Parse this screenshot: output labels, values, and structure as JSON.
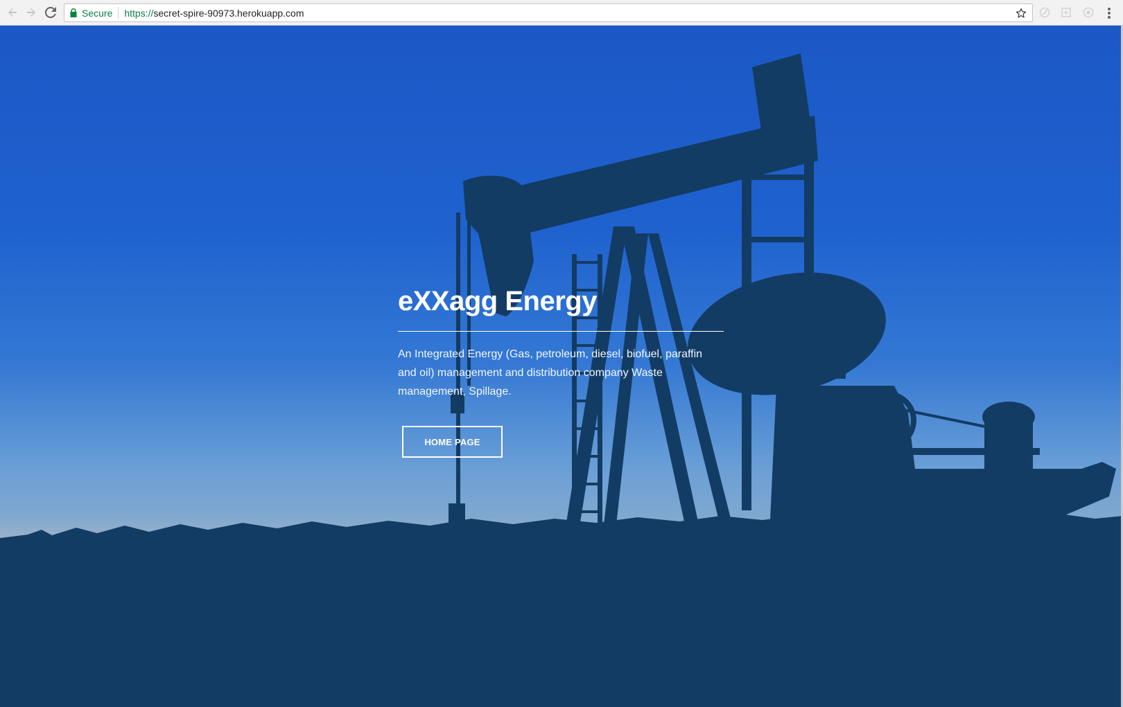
{
  "browser": {
    "secure_label": "Secure",
    "url_scheme": "https://",
    "url_host": "secret-spire-90973.herokuapp.com",
    "icons": [
      "back-arrow-icon",
      "forward-arrow-icon",
      "reload-icon",
      "lock-icon",
      "star-icon",
      "extension-icon",
      "menu-icon"
    ],
    "secure_color": "#0b8043"
  },
  "hero": {
    "title": "eXXagg Energy",
    "description": "An Integrated Energy (Gas, petroleum, diesel, biofuel, paraffin and oil) management and distribution company Waste management, Spillage.",
    "button_label": "HOME PAGE"
  },
  "colors": {
    "sky_top": "#1b58c6",
    "ground": "#0f355a",
    "silhouette": "#123a62",
    "text": "#ffffff"
  }
}
